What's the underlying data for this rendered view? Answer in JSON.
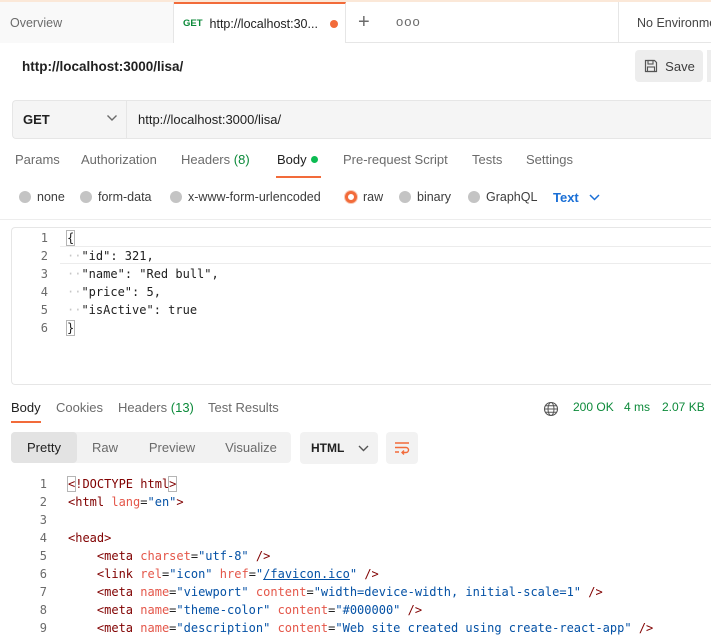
{
  "tabs": {
    "overview": "Overview",
    "active_method": "GET",
    "active_label": "http://localhost:30...",
    "plus": "+",
    "more": "ooo",
    "environment": "No Environment"
  },
  "request": {
    "title": "http://localhost:3000/lisa/",
    "save_label": "Save",
    "method": "GET",
    "url": "http://localhost:3000/lisa/"
  },
  "request_tabs": {
    "params": "Params",
    "authorization": "Authorization",
    "headers": "Headers",
    "headers_count": "(8)",
    "body": "Body",
    "prerequest": "Pre-request Script",
    "tests": "Tests",
    "settings": "Settings"
  },
  "body_types": {
    "none": "none",
    "form_data": "form-data",
    "urlencoded": "x-www-form-urlencoded",
    "raw": "raw",
    "binary": "binary",
    "graphql": "GraphQL",
    "text_select": "Text"
  },
  "request_body": {
    "line_numbers": [
      "1",
      "2",
      "3",
      "4",
      "5",
      "6"
    ],
    "l1": "{",
    "l2_key": "\"id\"",
    "l2_val": ": 321,",
    "l3_key": "\"name\"",
    "l3_val": ": \"Red bull\",",
    "l4_key": "\"price\"",
    "l4_val": ": 5,",
    "l5_key": "\"isActive\"",
    "l5_val": ": true",
    "l6": "}"
  },
  "response_tabs": {
    "body": "Body",
    "cookies": "Cookies",
    "headers": "Headers",
    "headers_count": "(13)",
    "test_results": "Test Results",
    "status": "200 OK",
    "time": "4 ms",
    "size": "2.07 KB"
  },
  "response_view": {
    "pretty": "Pretty",
    "raw": "Raw",
    "preview": "Preview",
    "visualize": "Visualize",
    "format": "HTML"
  },
  "response_body": {
    "line_numbers": [
      "1",
      "2",
      "3",
      "4",
      "5",
      "6",
      "7",
      "8",
      "9"
    ]
  },
  "colors": {
    "accent": "#f26b3a",
    "status_green": "#0c8a3a",
    "link_blue": "#1a6fd6"
  }
}
